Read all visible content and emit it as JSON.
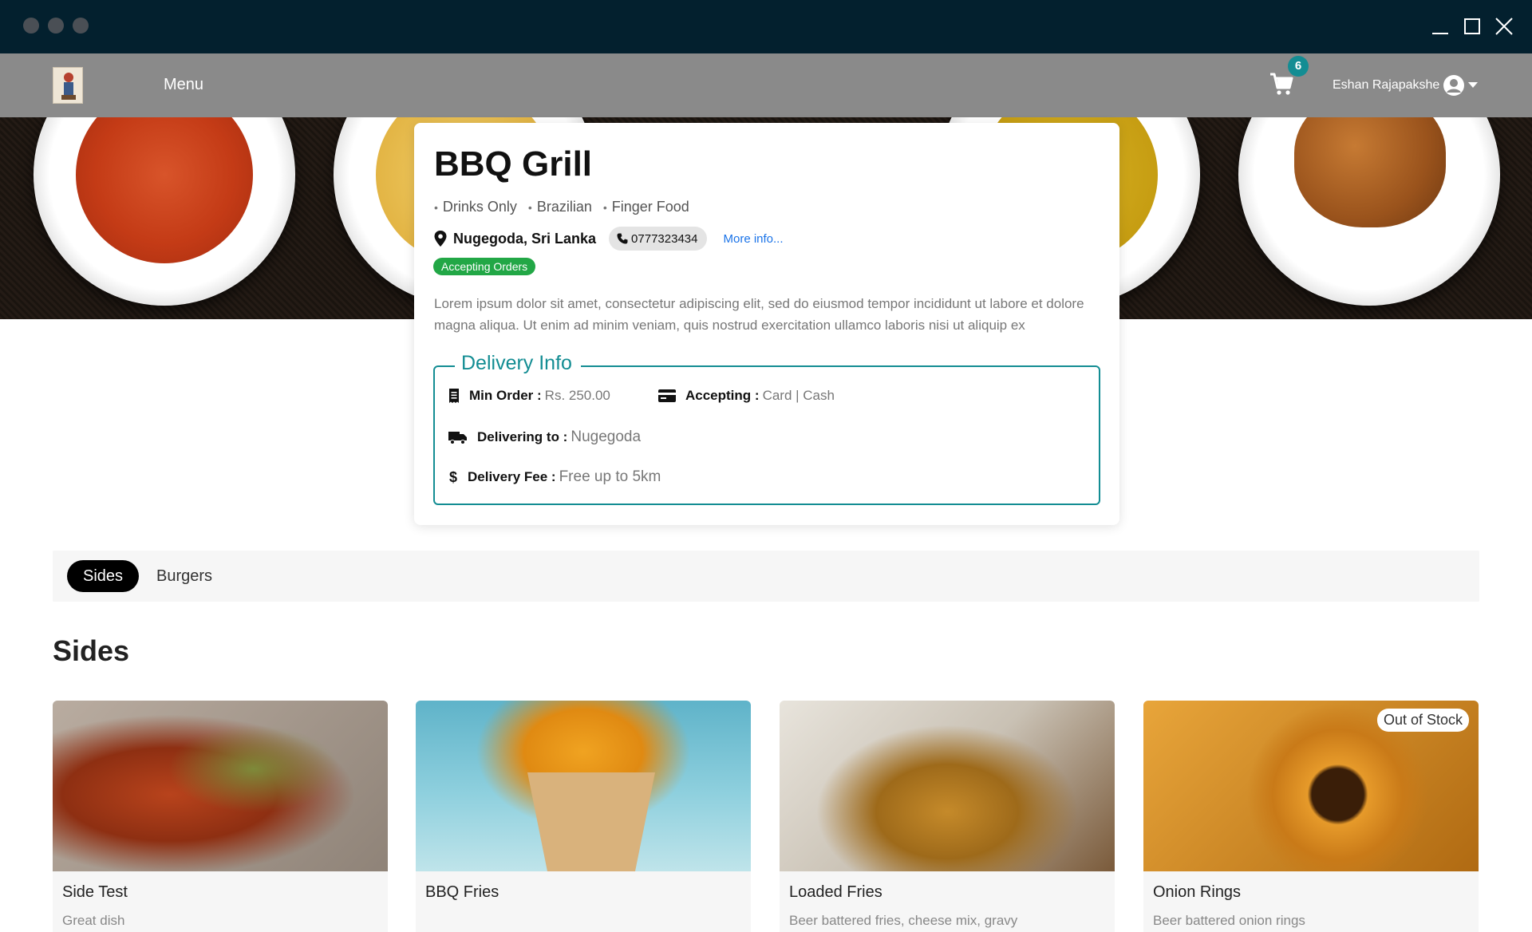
{
  "navbar": {
    "menu_label": "Menu",
    "cart_count": "6",
    "user_name": "Eshan Rajapakshe"
  },
  "restaurant": {
    "name": "BBQ Grill",
    "cuisines": [
      "Drinks Only",
      "Brazilian",
      "Finger Food"
    ],
    "location": "Nugegoda, Sri Lanka",
    "phone": "0777323434",
    "more_info": "More info...",
    "status": "Accepting Orders",
    "description": "Lorem ipsum dolor sit amet, consectetur adipiscing elit, sed do eiusmod tempor incididunt ut labore et dolore magna aliqua. Ut enim ad minim veniam, quis nostrud exercitation ullamco laboris nisi ut aliquip ex"
  },
  "delivery": {
    "legend": "Delivery Info",
    "min_order_label": "Min Order :",
    "min_order_value": "Rs. 250.00",
    "accepting_label": "Accepting :",
    "accepting_value": "Card | Cash",
    "delivering_label": "Delivering to :",
    "delivering_value": "Nugegoda",
    "fee_label": "Delivery Fee :",
    "fee_value": "Free up to 5km"
  },
  "categories": [
    {
      "label": "Sides",
      "active": true
    },
    {
      "label": "Burgers",
      "active": false
    }
  ],
  "section_title": "Sides",
  "products": [
    {
      "name": "Side Test",
      "description": "Great dish",
      "badge": ""
    },
    {
      "name": "BBQ Fries",
      "description": "",
      "badge": ""
    },
    {
      "name": "Loaded Fries",
      "description": "Beer battered fries, cheese mix, gravy",
      "badge": ""
    },
    {
      "name": "Onion Rings",
      "description": "Beer battered onion rings",
      "badge": "Out of Stock"
    }
  ],
  "colors": {
    "accent": "#138d93",
    "status_green": "#22a746",
    "navbar": "#8a8a8a",
    "titlebar": "#03202e"
  }
}
